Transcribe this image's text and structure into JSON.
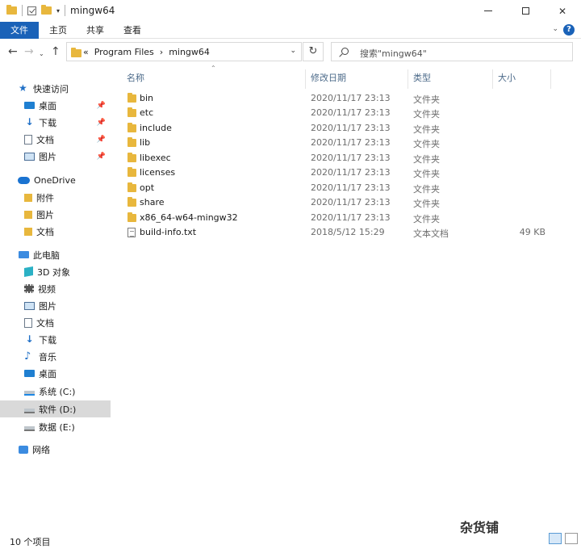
{
  "window": {
    "title": "mingw64",
    "controls": {
      "minimize": "—",
      "maximize": "☐",
      "close": "✕"
    }
  },
  "ribbon": {
    "tabs": [
      "文件",
      "主页",
      "共享",
      "查看"
    ],
    "help": "?"
  },
  "address": {
    "path_prefix": "«",
    "segments": [
      "Program Files",
      "mingw64"
    ],
    "separator": "›"
  },
  "search": {
    "placeholder": "搜索\"mingw64\""
  },
  "sidebar": {
    "quick_access": {
      "label": "快速访问",
      "items": [
        {
          "label": "桌面",
          "icon": "desktop-icon",
          "pinned": true
        },
        {
          "label": "下载",
          "icon": "download-icon",
          "pinned": true
        },
        {
          "label": "文档",
          "icon": "document-icon",
          "pinned": true
        },
        {
          "label": "图片",
          "icon": "pictures-icon",
          "pinned": true
        }
      ]
    },
    "onedrive": {
      "label": "OneDrive",
      "items": [
        {
          "label": "附件",
          "icon": "folder-icon"
        },
        {
          "label": "图片",
          "icon": "folder-icon"
        },
        {
          "label": "文档",
          "icon": "folder-icon"
        }
      ]
    },
    "this_pc": {
      "label": "此电脑",
      "items": [
        {
          "label": "3D 对象",
          "icon": "3d-objects-icon"
        },
        {
          "label": "视频",
          "icon": "videos-icon"
        },
        {
          "label": "图片",
          "icon": "pictures-icon"
        },
        {
          "label": "文档",
          "icon": "document-icon"
        },
        {
          "label": "下载",
          "icon": "download-icon"
        },
        {
          "label": "音乐",
          "icon": "music-icon"
        },
        {
          "label": "桌面",
          "icon": "desktop-icon"
        },
        {
          "label": "系统 (C:)",
          "icon": "drive-c-icon"
        },
        {
          "label": "软件 (D:)",
          "icon": "drive-icon",
          "selected": true
        },
        {
          "label": "数据 (E:)",
          "icon": "drive-icon"
        }
      ]
    },
    "network": {
      "label": "网络"
    }
  },
  "columns": [
    "名称",
    "修改日期",
    "类型",
    "大小"
  ],
  "files": [
    {
      "name": "bin",
      "date": "2020/11/17 23:13",
      "type": "文件夹",
      "size": "",
      "kind": "folder"
    },
    {
      "name": "etc",
      "date": "2020/11/17 23:13",
      "type": "文件夹",
      "size": "",
      "kind": "folder"
    },
    {
      "name": "include",
      "date": "2020/11/17 23:13",
      "type": "文件夹",
      "size": "",
      "kind": "folder"
    },
    {
      "name": "lib",
      "date": "2020/11/17 23:13",
      "type": "文件夹",
      "size": "",
      "kind": "folder"
    },
    {
      "name": "libexec",
      "date": "2020/11/17 23:13",
      "type": "文件夹",
      "size": "",
      "kind": "folder"
    },
    {
      "name": "licenses",
      "date": "2020/11/17 23:13",
      "type": "文件夹",
      "size": "",
      "kind": "folder"
    },
    {
      "name": "opt",
      "date": "2020/11/17 23:13",
      "type": "文件夹",
      "size": "",
      "kind": "folder"
    },
    {
      "name": "share",
      "date": "2020/11/17 23:13",
      "type": "文件夹",
      "size": "",
      "kind": "folder"
    },
    {
      "name": "x86_64-w64-mingw32",
      "date": "2020/11/17 23:13",
      "type": "文件夹",
      "size": "",
      "kind": "folder"
    },
    {
      "name": "build-info.txt",
      "date": "2018/5/12 15:29",
      "type": "文本文档",
      "size": "49 KB",
      "kind": "text"
    }
  ],
  "status": {
    "count": "10 个项目"
  },
  "watermark": "杂货铺",
  "colors": {
    "accent": "#1a62b8",
    "folder": "#e8b73d",
    "selected": "#d9d9d9"
  }
}
